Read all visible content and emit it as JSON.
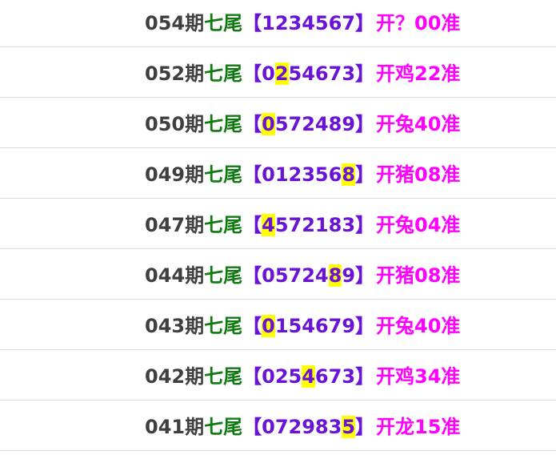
{
  "label": "七尾",
  "open_bracket": "【",
  "close_bracket": "】",
  "rows": [
    {
      "period": "054期",
      "digits": "1234567",
      "highlight": -1,
      "result": "开？00准"
    },
    {
      "period": "052期",
      "digits": "0254673",
      "highlight": 1,
      "result": "开鸡22准"
    },
    {
      "period": "050期",
      "digits": "0572489",
      "highlight": 0,
      "result": "开兔40准"
    },
    {
      "period": "049期",
      "digits": "0123568",
      "highlight": 6,
      "result": "开猪08准"
    },
    {
      "period": "047期",
      "digits": "4572183",
      "highlight": 0,
      "result": "开兔04准"
    },
    {
      "period": "044期",
      "digits": "0572489",
      "highlight": 5,
      "result": "开猪08准"
    },
    {
      "period": "043期",
      "digits": "0154679",
      "highlight": 0,
      "result": "开兔40准"
    },
    {
      "period": "042期",
      "digits": "0254673",
      "highlight": 3,
      "result": "开鸡34准"
    },
    {
      "period": "041期",
      "digits": "0729835",
      "highlight": 6,
      "result": "开龙15准"
    }
  ],
  "colors": {
    "period": "#3f3f3f",
    "label": "#0f7a0f",
    "digits": "#6a12d6",
    "result": "#ff00ff",
    "highlight": "#ffff00"
  }
}
